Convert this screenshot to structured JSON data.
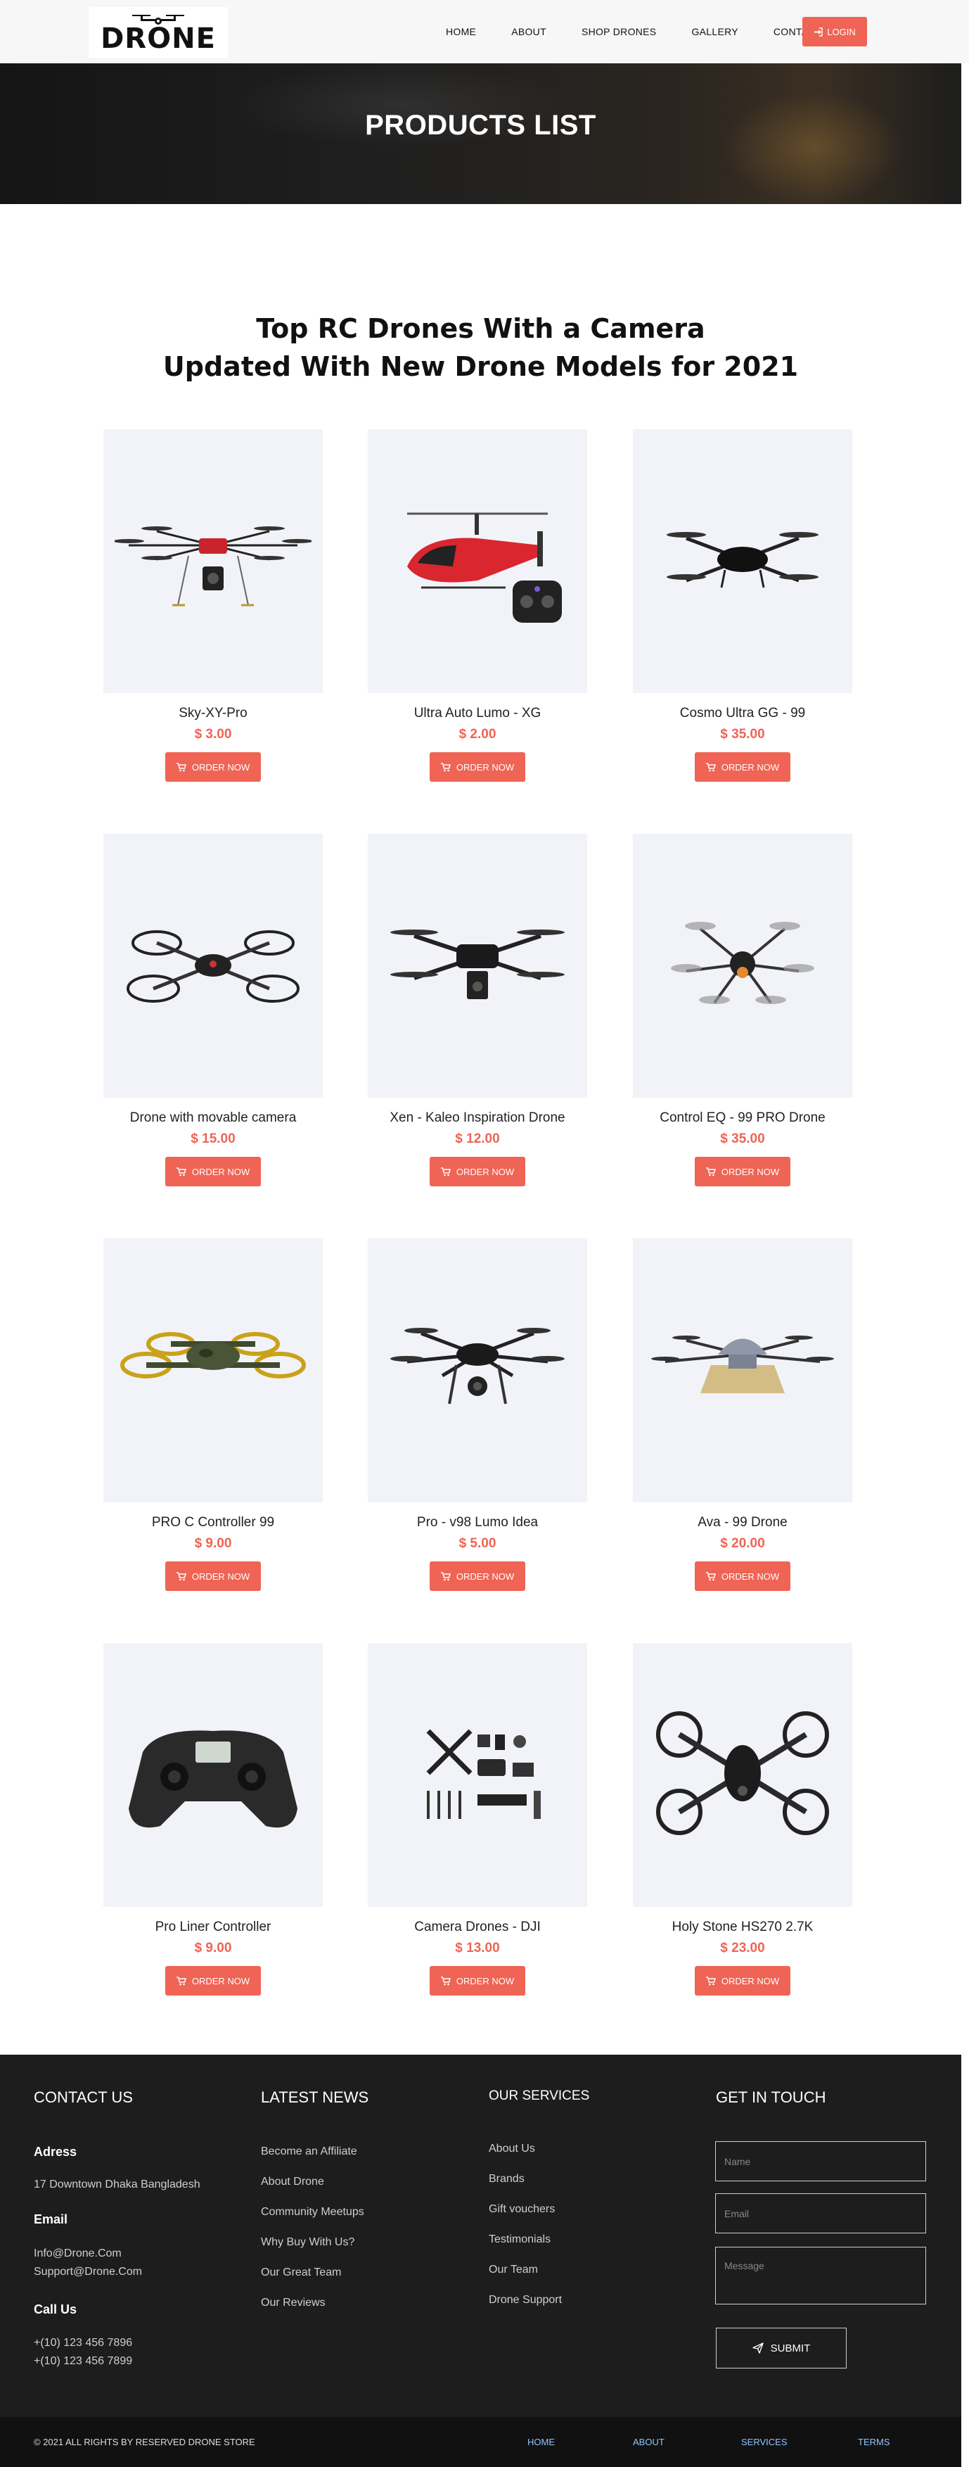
{
  "header": {
    "logo_text": "DRONE",
    "nav": [
      "HOME",
      "ABOUT",
      "SHOP DRONES",
      "GALLERY",
      "CONTACT"
    ],
    "login_label": "LOGIN"
  },
  "banner": {
    "title": "PRODUCTS LIST"
  },
  "section": {
    "title_line1": "Top RC Drones With a Camera",
    "title_line2": "Updated With New Drone Models for 2021"
  },
  "order_label": "ORDER NOW",
  "products": [
    {
      "name": "Sky-XY-Pro",
      "price": "$ 3.00",
      "icon": "drone-hexacopter-red"
    },
    {
      "name": "Ultra Auto Lumo - XG",
      "price": "$ 2.00",
      "icon": "rc-helicopter"
    },
    {
      "name": "Cosmo Ultra GG - 99",
      "price": "$ 35.00",
      "icon": "quadcopter-black"
    },
    {
      "name": "Drone with movable camera",
      "price": "$ 15.00",
      "icon": "quadcopter-guards"
    },
    {
      "name": "Xen - Kaleo Inspiration Drone",
      "price": "$ 12.00",
      "icon": "quadcopter-camera"
    },
    {
      "name": "Control EQ - 99 PRO Drone",
      "price": "$ 35.00",
      "icon": "hexacopter-flying"
    },
    {
      "name": "PRO C Controller 99",
      "price": "$ 9.00",
      "icon": "quadcopter-camo"
    },
    {
      "name": "Pro - v98 Lumo Idea",
      "price": "$ 5.00",
      "icon": "hexacopter-gimbal"
    },
    {
      "name": "Ava - 99 Drone",
      "price": "$ 20.00",
      "icon": "hexacopter-sprayer"
    },
    {
      "name": "Pro Liner Controller",
      "price": "$ 9.00",
      "icon": "rc-controller"
    },
    {
      "name": "Camera Drones - DJI",
      "price": "$ 13.00",
      "icon": "drone-parts-kit"
    },
    {
      "name": "Holy Stone HS270 2.7K",
      "price": "$ 23.00",
      "icon": "quadcopter-racing"
    }
  ],
  "footer": {
    "contact": {
      "title": "CONTACT US",
      "address_label": "Adress",
      "address": "17 Downtown Dhaka Bangladesh",
      "email_label": "Email",
      "email1": "Info@Drone.Com",
      "email2": "Support@Drone.Com",
      "call_label": "Call Us",
      "phone1": "+(10) 123 456 7896",
      "phone2": "+(10) 123 456 7899"
    },
    "news": {
      "title": "LATEST NEWS",
      "items": [
        "Become an Affiliate",
        "About Drone",
        "Community Meetups",
        "Why Buy With Us?",
        "Our Great Team",
        "Our Reviews"
      ]
    },
    "services": {
      "title": "OUR SERVICES",
      "items": [
        "About Us",
        "Brands",
        "Gift vouchers",
        "Testimonials",
        "Our Team",
        "Drone Support"
      ]
    },
    "touch": {
      "title": "GET IN TOUCH",
      "name_placeholder": "Name",
      "email_placeholder": "Email",
      "message_placeholder": "Message",
      "submit_label": "SUBMIT"
    }
  },
  "bottom": {
    "copyright": "© 2021 ALL RIGHTS BY RESERVED DRONE STORE",
    "links": [
      "HOME",
      "ABOUT",
      "SERVICES",
      "TERMS"
    ]
  }
}
